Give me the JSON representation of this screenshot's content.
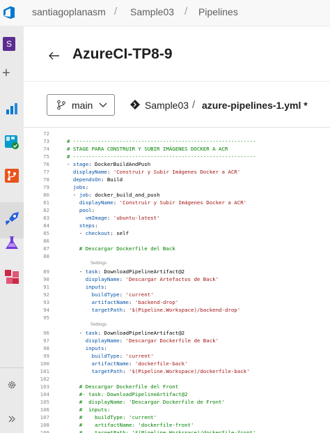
{
  "breadcrumb": {
    "org": "santiagoplanasm",
    "project": "Sample03",
    "page": "Pipelines",
    "separator": "/"
  },
  "project_avatar": "S",
  "pipeline_title": "AzureCI-TP8-9",
  "branch": {
    "name": "main"
  },
  "path": {
    "repo": "Sample03",
    "separator": "/",
    "file": "azure-pipelines-1.yml *"
  },
  "colors": {
    "accent": "#0078d4",
    "comment": "#008000",
    "key": "#0451a5",
    "string": "#a31515",
    "project": "#5c2d91"
  },
  "rail_icons": [
    "overview-icon",
    "boards-icon",
    "repos-icon",
    "pipelines-icon",
    "test-plans-icon",
    "artifacts-icon",
    "settings-icon",
    "expand-icon"
  ],
  "settings_label": "Settings",
  "code_lines": [
    {
      "n": "72",
      "t": ""
    },
    {
      "n": "73",
      "t": "# -----------------------------------------------------------"
    },
    {
      "n": "74",
      "t": "# STAGE PARA CONSTRUIR Y SUBIR IMÁGENES DOCKER A ACR"
    },
    {
      "n": "75",
      "t": "# -----------------------------------------------------------"
    },
    {
      "n": "76",
      "t": "- stage: DockerBuildAndPush"
    },
    {
      "n": "77",
      "t": "  displayName: 'Construir y Subir Imágenes Docker a ACR'"
    },
    {
      "n": "78",
      "t": "  dependsOn: Build"
    },
    {
      "n": "79",
      "t": "  jobs:"
    },
    {
      "n": "80",
      "t": "  - job: docker_build_and_push"
    },
    {
      "n": "81",
      "t": "    displayName: 'Construir y Subir Imágenes Docker a ACR'"
    },
    {
      "n": "82",
      "t": "    pool:"
    },
    {
      "n": "83",
      "t": "      vmImage: 'ubuntu-latest'"
    },
    {
      "n": "84",
      "t": "    steps:"
    },
    {
      "n": "85",
      "t": "    - checkout: self"
    },
    {
      "n": "86",
      "t": ""
    },
    {
      "n": "87",
      "t": "    # Descargar Dockerfile del Back"
    },
    {
      "n": "88",
      "t": ""
    },
    {
      "n": "89",
      "t": "    - task: DownloadPipelineArtifact@2"
    },
    {
      "n": "90",
      "t": "      displayName: 'Descargar Artefactos de Back'"
    },
    {
      "n": "91",
      "t": "      inputs:"
    },
    {
      "n": "92",
      "t": "        buildType: 'current'"
    },
    {
      "n": "93",
      "t": "        artifactName: 'backend-drop'"
    },
    {
      "n": "94",
      "t": "        targetPath: '$(Pipeline.Workspace)/backend-drop'"
    },
    {
      "n": "95",
      "t": ""
    },
    {
      "n": "96",
      "t": "    - task: DownloadPipelineArtifact@2"
    },
    {
      "n": "97",
      "t": "      displayName: 'Descargar Dockerfile de Back'"
    },
    {
      "n": "98",
      "t": "      inputs:"
    },
    {
      "n": "99",
      "t": "        buildType: 'current'"
    },
    {
      "n": "100",
      "t": "        artifactName: 'dockerfile-back'"
    },
    {
      "n": "101",
      "t": "        targetPath: '$(Pipeline.Workspace)/dockerfile-back'"
    },
    {
      "n": "102",
      "t": ""
    },
    {
      "n": "103",
      "t": "    # Descargar Dockerfile del Front"
    },
    {
      "n": "104",
      "t": "    #- task: DownloadPipelineArtifact@2"
    },
    {
      "n": "105",
      "t": "    #  displayName: 'Descargar Dockerfile de Front'"
    },
    {
      "n": "106",
      "t": "    #  inputs:"
    },
    {
      "n": "107",
      "t": "    #    buildType: 'current'"
    },
    {
      "n": "108",
      "t": "    #    artifactName: 'dockerfile-front'"
    },
    {
      "n": "109",
      "t": "    #    targetPath: '$(Pipeline.Workspace)/dockerfile-front'"
    }
  ]
}
